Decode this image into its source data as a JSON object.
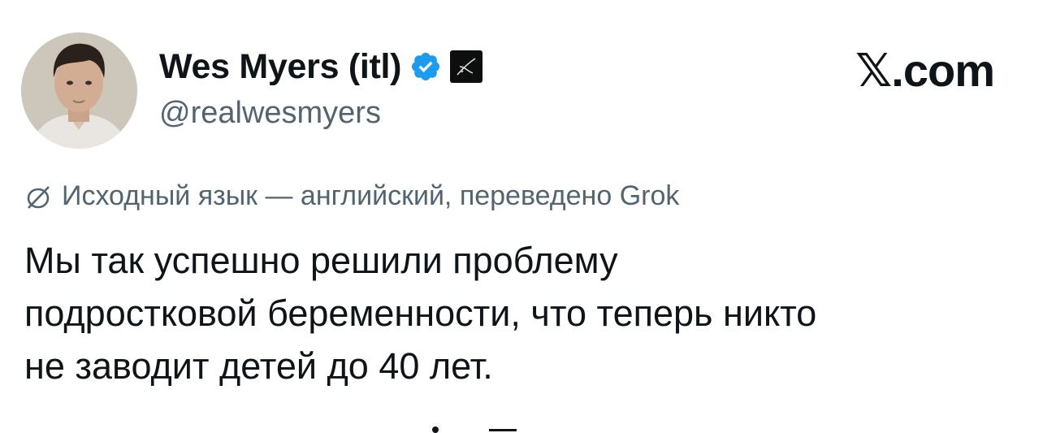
{
  "author": {
    "display_name": "Wes Myers (itl)",
    "handle": "@realwesmyers",
    "verified_icon": "verified-badge-icon",
    "affiliation_icon": "affiliation-badge-icon",
    "avatar": "profile-photo"
  },
  "brand": {
    "logo_text": "𝕏.com"
  },
  "translation": {
    "icon": "translate-icon",
    "label": "Исходный язык — английский, переведено Grok"
  },
  "tweet": {
    "lines": [
      "Мы так успешно решили проблему",
      "подростковой беременности, что теперь никто",
      "не заводит детей до 40 лет."
    ]
  },
  "colors": {
    "text_primary": "#0f1419",
    "text_secondary": "#536471",
    "verified_blue": "#1d9bf0",
    "background": "#ffffff"
  }
}
